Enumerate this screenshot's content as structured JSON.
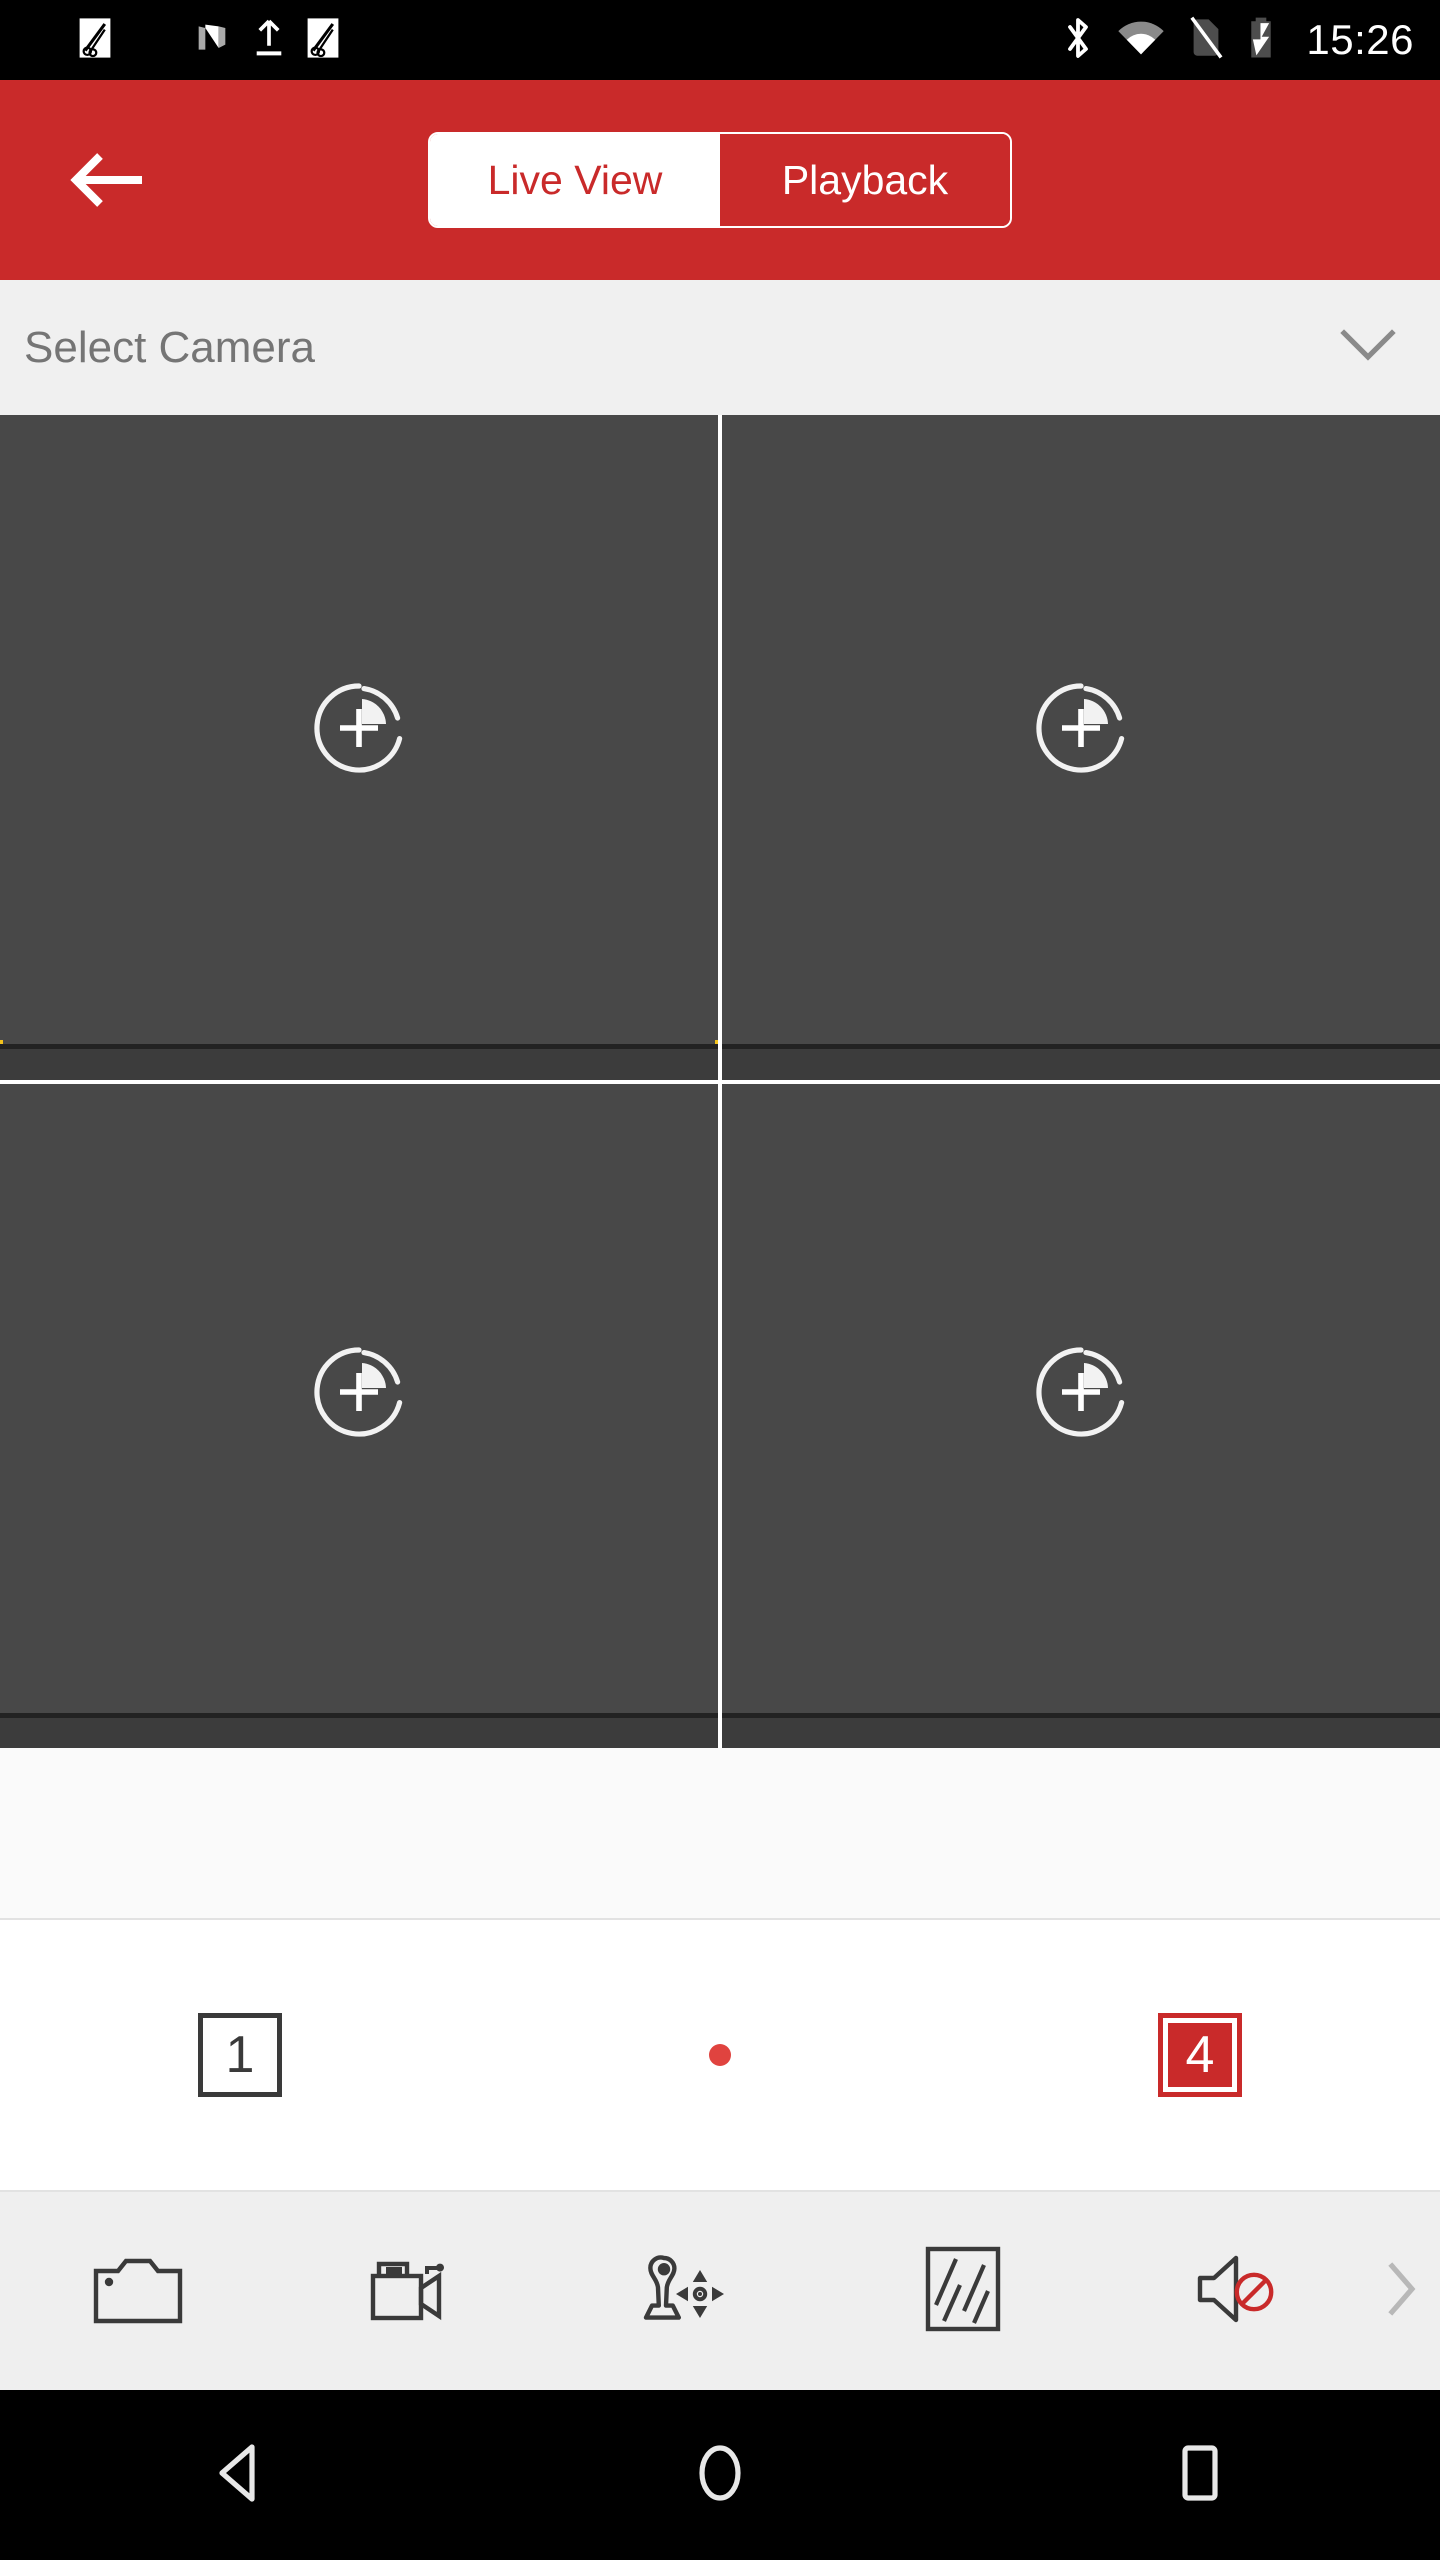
{
  "statusbar": {
    "clock": "15:26",
    "left_icons": [
      {
        "name": "app-badge-icon-1"
      },
      {
        "name": "scissors-icon-1"
      },
      {
        "name": "app-badge-icon-2"
      },
      {
        "name": "n-logo-icon"
      },
      {
        "name": "upload-icon"
      },
      {
        "name": "scissors-icon-2"
      }
    ],
    "right_icons": [
      {
        "name": "bluetooth-icon"
      },
      {
        "name": "wifi-icon"
      },
      {
        "name": "no-sim-icon"
      },
      {
        "name": "battery-charging-icon"
      }
    ]
  },
  "header": {
    "back_label": "back-arrow-icon",
    "tabs": [
      {
        "label": "Live View",
        "active": true
      },
      {
        "label": "Playback",
        "active": false
      }
    ],
    "background_color": "#c92a2a"
  },
  "camera_select": {
    "label": "Select Camera",
    "chevron": "chevron-down-icon"
  },
  "grid": {
    "layout": "2x2",
    "selected_index": 0,
    "selection_color": "#f2c21c",
    "cells": [
      {
        "index": 0,
        "placeholder_icon": "add-camera-icon",
        "selected": true
      },
      {
        "index": 1,
        "placeholder_icon": "add-camera-icon",
        "selected": false
      },
      {
        "index": 2,
        "placeholder_icon": "add-camera-icon",
        "selected": false
      },
      {
        "index": 3,
        "placeholder_icon": "add-camera-icon",
        "selected": false
      }
    ]
  },
  "control_panel": {
    "layout_single": "1",
    "layout_quad": "4",
    "selected_layout": "4",
    "page_indicator_color": "#e0433f"
  },
  "toolbar": {
    "items": [
      {
        "name": "snapshot-icon",
        "label": "Snapshot"
      },
      {
        "name": "record-icon",
        "label": "Record"
      },
      {
        "name": "ptz-icon",
        "label": "PTZ"
      },
      {
        "name": "stream-quality-icon",
        "label": "Quality"
      },
      {
        "name": "audio-muted-icon",
        "label": "Audio Muted"
      }
    ],
    "more": "chevron-right-icon"
  },
  "navbar": {
    "back": "nav-back-icon",
    "home": "nav-home-icon",
    "recents": "nav-recents-icon"
  }
}
